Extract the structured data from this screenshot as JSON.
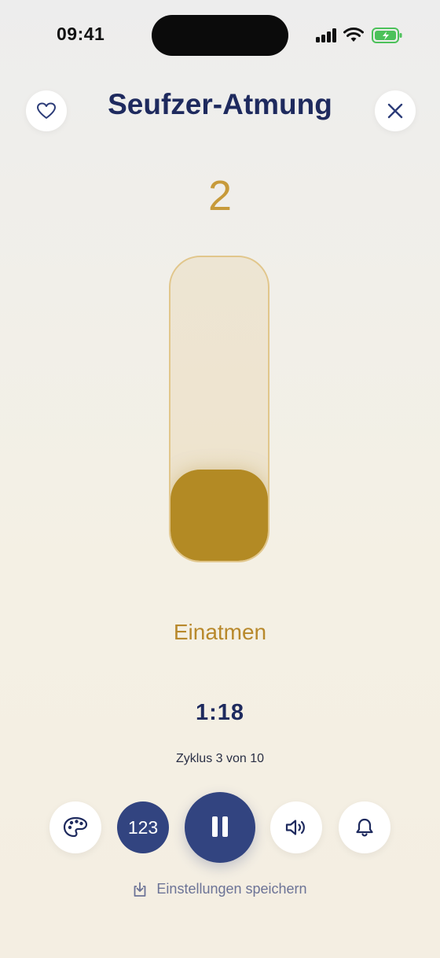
{
  "status_bar": {
    "time": "09:41"
  },
  "header": {
    "title": "Seufzer-Atmung",
    "favorite_icon": "heart-icon",
    "close_icon": "close-icon"
  },
  "exercise": {
    "counter": "2",
    "phase": "Einatmen",
    "fill_fraction": 0.3,
    "timer": "1:18",
    "cycle": "Zyklus 3 von 10"
  },
  "controls": {
    "palette_icon": "palette-icon",
    "count_label": "123",
    "pause_icon": "pause-icon",
    "sound_icon": "speaker-icon",
    "bell_icon": "bell-icon"
  },
  "footer": {
    "save_label": "Einstellungen speichern",
    "save_icon": "download-icon"
  },
  "colors": {
    "title": "#1e2a5e",
    "accent_gold": "#b38a24",
    "primary_blue": "#324480"
  }
}
